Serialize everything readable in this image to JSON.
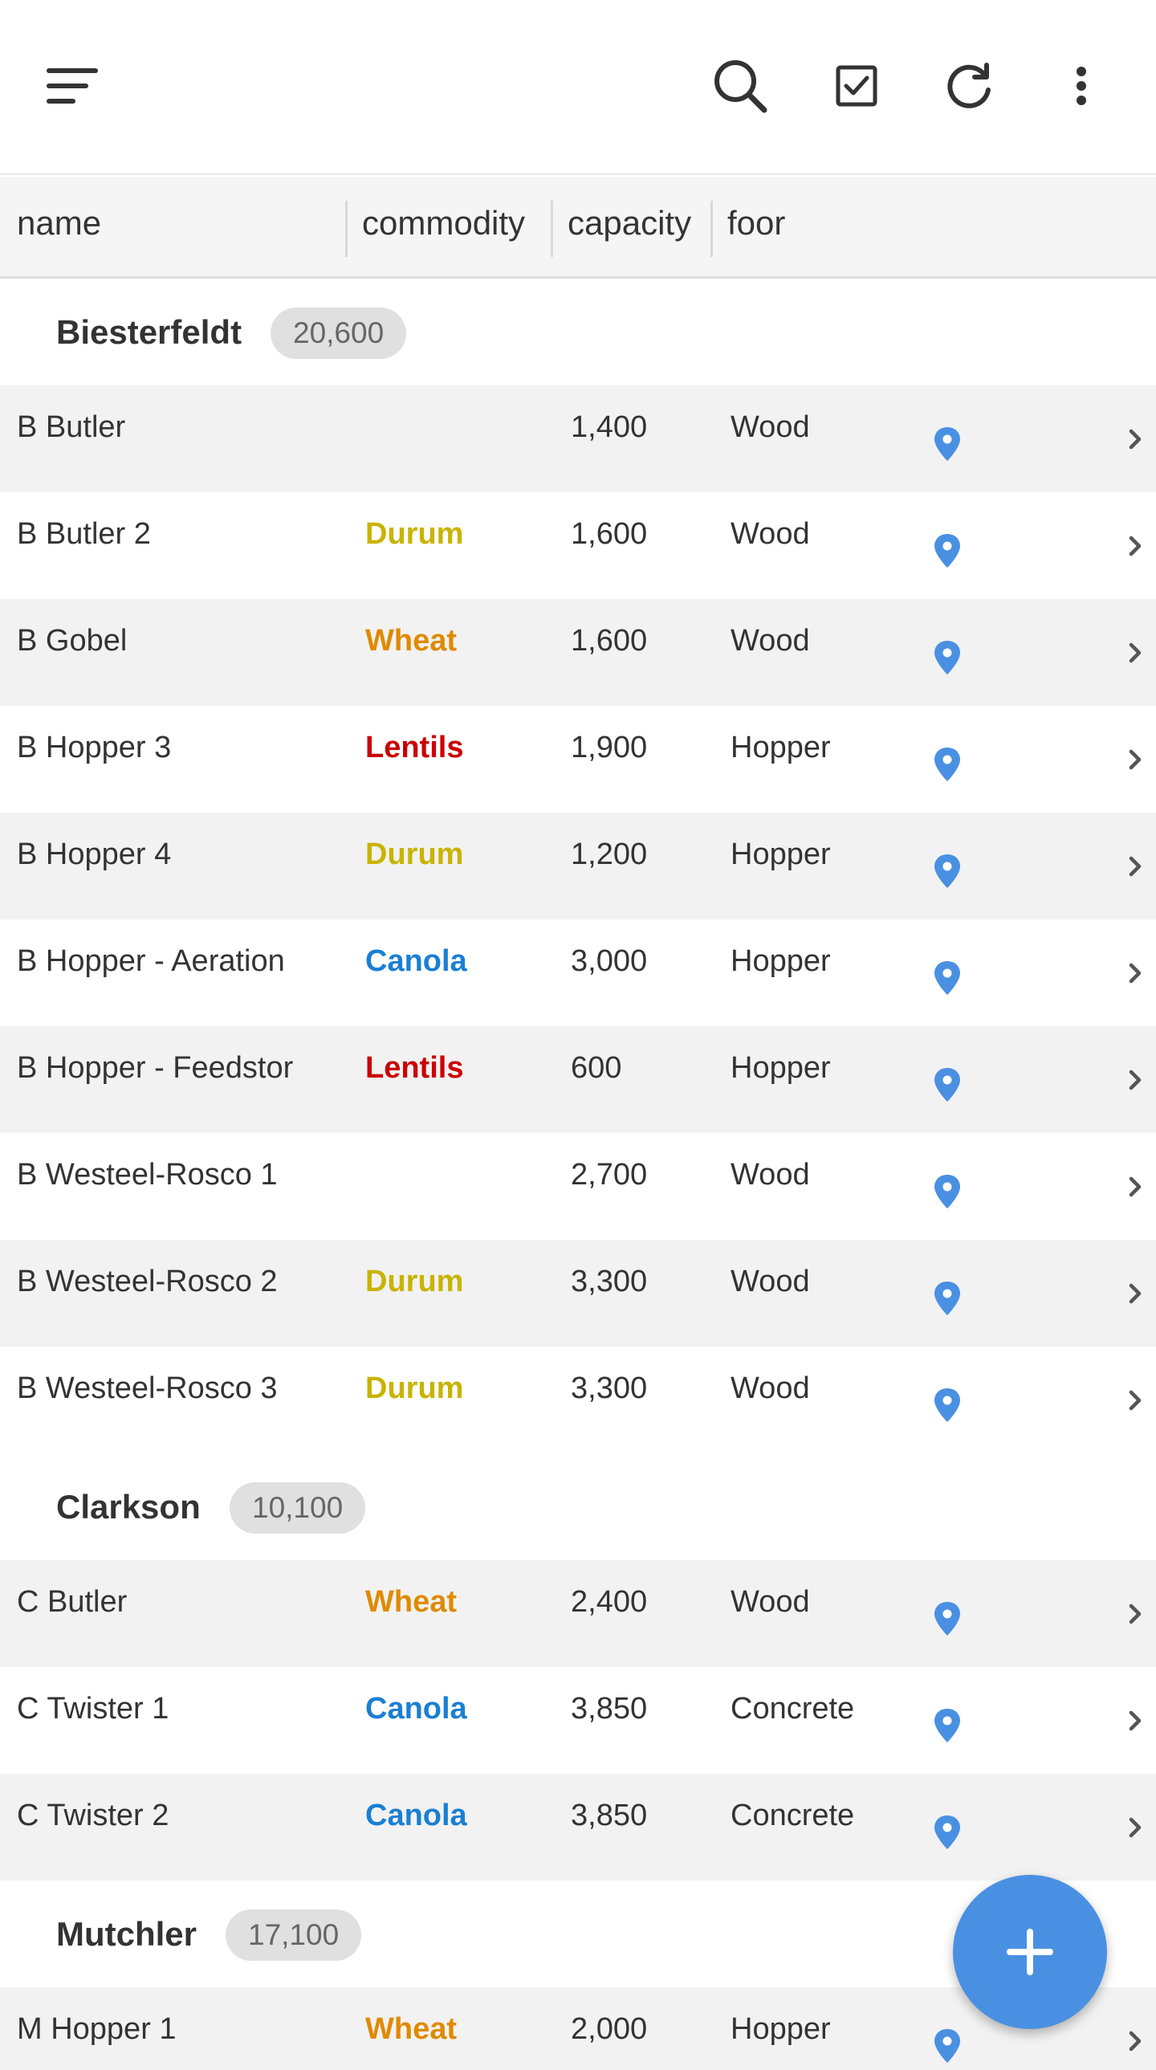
{
  "toolbar": {
    "icons": [
      "sort-menu-icon",
      "search-icon",
      "checkbox-icon",
      "refresh-icon",
      "more-vert-icon"
    ]
  },
  "columns": {
    "name": "name",
    "commodity": "commodity",
    "capacity": "capacity",
    "floor": "foor"
  },
  "commodity_colors": {
    "Durum": "#c9b300",
    "Wheat": "#e08a00",
    "Lentils": "#cc0000",
    "Canola": "#1a7fd4"
  },
  "accent_color": "#4a90e2",
  "groups": [
    {
      "name": "Biesterfeldt",
      "total": "20,600",
      "rows": [
        {
          "name": "B Butler",
          "commodity": "",
          "capacity": "1,400",
          "floor": "Wood"
        },
        {
          "name": "B Butler 2",
          "commodity": "Durum",
          "capacity": "1,600",
          "floor": "Wood"
        },
        {
          "name": "B Gobel",
          "commodity": "Wheat",
          "capacity": "1,600",
          "floor": "Wood"
        },
        {
          "name": "B Hopper 3",
          "commodity": "Lentils",
          "capacity": "1,900",
          "floor": "Hopper"
        },
        {
          "name": "B Hopper 4",
          "commodity": "Durum",
          "capacity": "1,200",
          "floor": "Hopper"
        },
        {
          "name": "B Hopper - Aeration",
          "commodity": "Canola",
          "capacity": "3,000",
          "floor": "Hopper"
        },
        {
          "name": "B Hopper - Feedstor",
          "commodity": "Lentils",
          "capacity": "600",
          "floor": "Hopper"
        },
        {
          "name": "B Westeel-Rosco 1",
          "commodity": "",
          "capacity": "2,700",
          "floor": "Wood"
        },
        {
          "name": "B Westeel-Rosco 2",
          "commodity": "Durum",
          "capacity": "3,300",
          "floor": "Wood"
        },
        {
          "name": "B Westeel-Rosco 3",
          "commodity": "Durum",
          "capacity": "3,300",
          "floor": "Wood"
        }
      ]
    },
    {
      "name": "Clarkson",
      "total": "10,100",
      "rows": [
        {
          "name": "C Butler",
          "commodity": "Wheat",
          "capacity": "2,400",
          "floor": "Wood"
        },
        {
          "name": "C Twister 1",
          "commodity": "Canola",
          "capacity": "3,850",
          "floor": "Concrete"
        },
        {
          "name": "C Twister 2",
          "commodity": "Canola",
          "capacity": "3,850",
          "floor": "Concrete"
        }
      ]
    },
    {
      "name": "Mutchler",
      "total": "17,100",
      "rows": [
        {
          "name": "M Hopper 1",
          "commodity": "Wheat",
          "capacity": "2,000",
          "floor": "Hopper"
        }
      ]
    }
  ]
}
